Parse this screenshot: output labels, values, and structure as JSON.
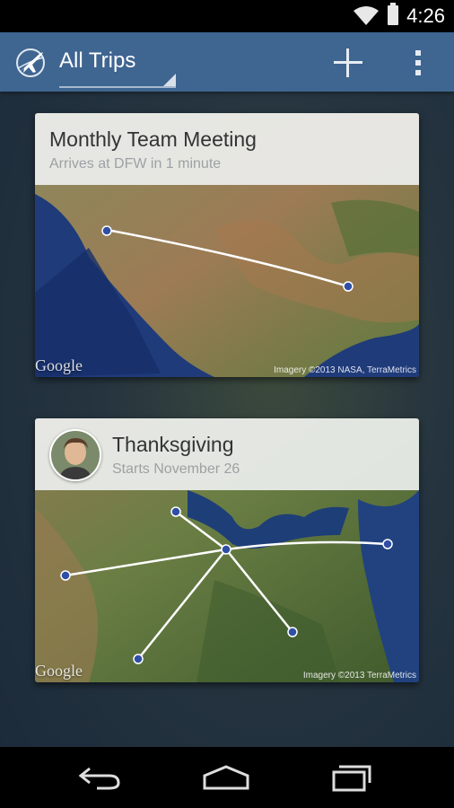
{
  "status_bar": {
    "time": "4:26",
    "wifi_icon": "wifi-icon",
    "battery_icon": "battery-icon"
  },
  "action_bar": {
    "app_icon": "airplane-globe-icon",
    "title": "All Trips",
    "add_icon": "plus-icon",
    "overflow_icon": "overflow-menu-icon"
  },
  "trips": [
    {
      "title": "Monthly Team Meeting",
      "subtitle": "Arrives at DFW in 1 minute",
      "map_logo": "Google",
      "attribution": "Imagery ©2013 NASA, TerraMetrics"
    },
    {
      "title": "Thanksgiving",
      "subtitle": "Starts November 26",
      "map_logo": "Google",
      "attribution": "Imagery ©2013 TerraMetrics",
      "avatar_icon": "person-avatar"
    }
  ],
  "nav_bar": {
    "back_icon": "back-icon",
    "home_icon": "home-icon",
    "recents_icon": "recents-icon"
  },
  "colors": {
    "action_bar": "#3f6591",
    "route_point": "#2f4fa6",
    "route_line": "#ffffff"
  }
}
